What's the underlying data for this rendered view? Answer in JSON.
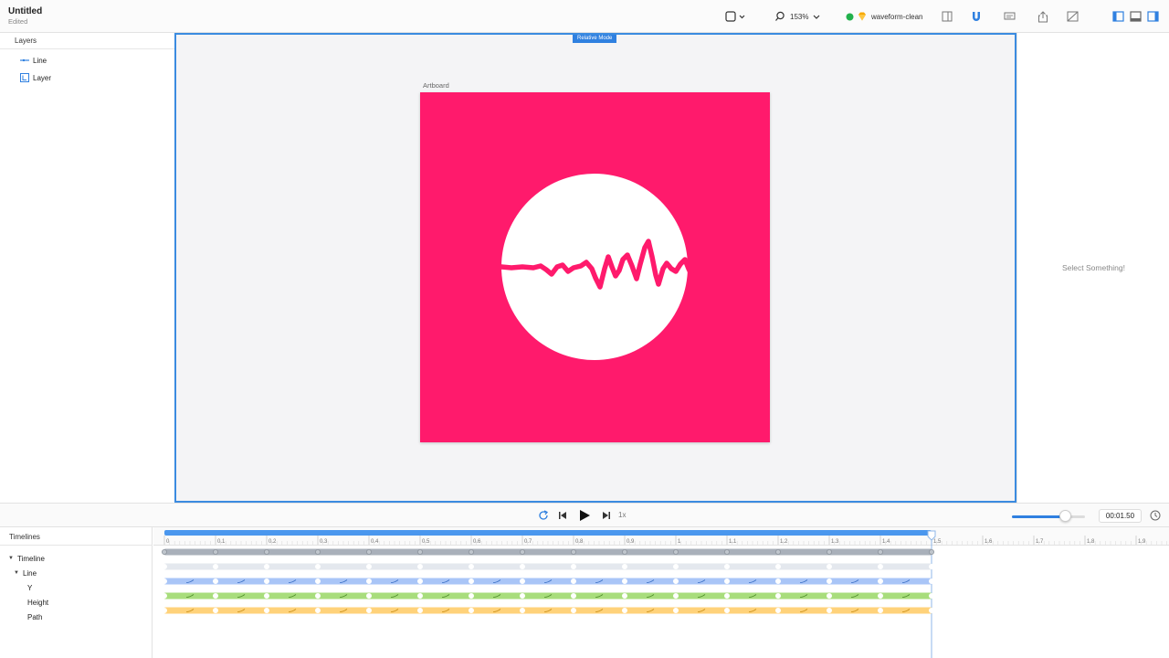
{
  "document": {
    "title": "Untitled",
    "status": "Edited"
  },
  "toolbar": {
    "zoom": "153%",
    "library_name": "waveform-clean",
    "status_color": "#22b14c",
    "accent": "#2f80e0"
  },
  "layers": {
    "header": "Layers",
    "items": [
      {
        "label": "Line",
        "icon": "line-icon"
      },
      {
        "label": "Layer",
        "icon": "layer-icon"
      }
    ]
  },
  "canvas": {
    "mode_badge": "Relative Mode",
    "artboard_label": "Artboard",
    "artboard_color": "#ff1a6c"
  },
  "inspector": {
    "placeholder": "Select Something!"
  },
  "transport": {
    "speed": "1x",
    "timecode": "00:01.50",
    "zoom_fraction": 0.73
  },
  "timelines": {
    "header": "Timelines",
    "tree": [
      {
        "label": "Timeline",
        "expanded": true
      },
      {
        "label": "Line",
        "expanded": true
      },
      {
        "label": "Y"
      },
      {
        "label": "Height"
      },
      {
        "label": "Path"
      }
    ],
    "ruler_labels": [
      "0",
      "0.1",
      "0.2",
      "0.3",
      "0.4",
      "0.5",
      "0.6",
      "0.7",
      "0.8",
      "0.9",
      "1",
      "1.1",
      "1.2",
      "1.3",
      "1.4",
      "1.5",
      "1.6",
      "1.7",
      "1.8",
      "1.9"
    ],
    "track_colors": [
      "#a9b0ba",
      "#e4e8ee",
      "#a9c5f7",
      "#a8dd7c",
      "#ffd27a"
    ],
    "duration": 1.5
  }
}
